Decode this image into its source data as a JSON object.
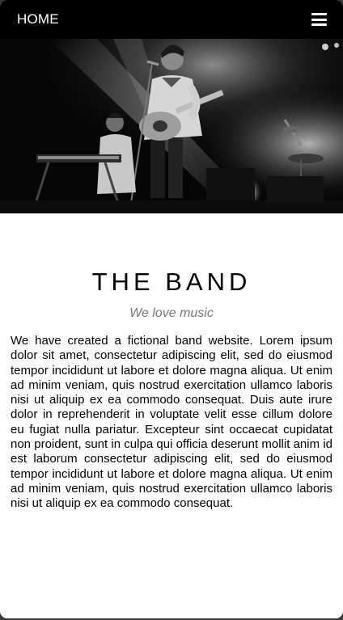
{
  "navbar": {
    "home_label": "HOME",
    "menu_icon": "hamburger-menu-icon"
  },
  "hero": {
    "description_icon": "band-photo"
  },
  "section": {
    "title": "THE BAND",
    "subtitle": "We love music",
    "body": "We have created a fictional band website. Lorem ipsum dolor sit amet, consectetur adipiscing elit, sed do eiusmod tempor incididunt ut labore et dolore magna aliqua. Ut enim ad minim veniam, quis nostrud exercitation ullamco laboris nisi ut aliquip ex ea commodo consequat. Duis aute irure dolor in reprehenderit in voluptate velit esse cillum dolore eu fugiat nulla pariatur. Excepteur sint occaecat cupidatat non proident, sunt in culpa qui officia deserunt mollit anim id est laborum consectetur adipiscing elit, sed do eiusmod tempor incididunt ut labore et dolore magna aliqua. Ut enim ad minim veniam, quis nostrud exercitation ullamco laboris nisi ut aliquip ex ea commodo consequat."
  },
  "colors": {
    "navbar_bg": "#000000",
    "page_bg": "#ffffff",
    "subtitle": "#777777"
  }
}
